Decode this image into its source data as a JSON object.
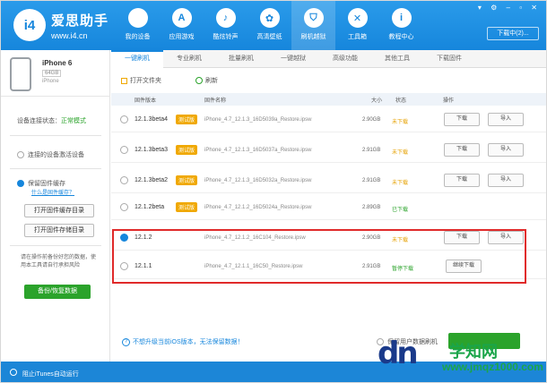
{
  "app": {
    "brand": "爱思助手",
    "url": "www.i4.cn",
    "logo": "i4",
    "download_center": "下载中(2)..."
  },
  "nav": [
    {
      "label": "我的设备",
      "icon": ""
    },
    {
      "label": "应用游戏",
      "icon": "A"
    },
    {
      "label": "酷炫铃声",
      "icon": "♪"
    },
    {
      "label": "高清壁纸",
      "icon": "✿"
    },
    {
      "label": "刷机越狱",
      "icon": "⛉"
    },
    {
      "label": "工具箱",
      "icon": "✕"
    },
    {
      "label": "教程中心",
      "icon": "i"
    }
  ],
  "device": {
    "name": "iPhone 6",
    "capacity": "64GB",
    "color": "iPhone"
  },
  "sidebar": {
    "status_label": "设备连接状态：",
    "status_value": "正常模式",
    "opt1": "连接的设备激活设备",
    "opt2": "保留固件缓存",
    "opt2_link": "什么是固件缓存？",
    "btn1": "打开固件缓存目录",
    "btn2": "打开固件存储目录",
    "note": "请在操作前备份好您的数据，使用本工具请自行承担风险",
    "backup": "备份/恢复数据",
    "itunes": "阻止iTunes自动运行"
  },
  "tabs": [
    "一键刷机",
    "专业刷机",
    "批量刷机",
    "一键越狱",
    "高级功能",
    "其他工具",
    "下载固件"
  ],
  "toolbar": {
    "open": "打开文件夹",
    "refresh": "刷新"
  },
  "table": {
    "headers": {
      "version": "固件版本",
      "name": "固件名称",
      "size": "大小",
      "status": "状态",
      "action": "操作"
    },
    "rows": [
      {
        "version": "12.1.3beta4",
        "tag": "测试版",
        "name": "iPhone_4.7_12.1.3_16D5039a_Restore.ipsw",
        "size": "2.90GB",
        "status": "未下载",
        "status_color": "#e6a100",
        "b1": "下载",
        "b2": "导入",
        "selected": false
      },
      {
        "version": "12.1.3beta3",
        "tag": "测试版",
        "name": "iPhone_4.7_12.1.3_16D5037a_Restore.ipsw",
        "size": "2.91GB",
        "status": "未下载",
        "status_color": "#e6a100",
        "b1": "下载",
        "b2": "导入",
        "selected": false
      },
      {
        "version": "12.1.3beta2",
        "tag": "测试版",
        "name": "iPhone_4.7_12.1.3_16D5032a_Restore.ipsw",
        "size": "2.91GB",
        "status": "未下载",
        "status_color": "#e6a100",
        "b1": "下载",
        "b2": "导入",
        "selected": false
      },
      {
        "version": "12.1.2beta",
        "tag": "测试版",
        "name": "iPhone_4.7_12.1.2_16D5024a_Restore.ipsw",
        "size": "2.89GB",
        "status": "已下载",
        "status_color": "#2ba32b",
        "b1": "",
        "b2": "",
        "selected": false
      },
      {
        "version": "12.1.2",
        "tag": "",
        "name": "iPhone_4.7_12.1.2_16C104_Restore.ipsw",
        "size": "2.90GB",
        "status": "未下载",
        "status_color": "#e6a100",
        "b1": "下载",
        "b2": "导入",
        "selected": true
      },
      {
        "version": "12.1.1",
        "tag": "",
        "name": "iPhone_4.7_12.1.1_16C50_Restore.ipsw",
        "size": "2.91GB",
        "status": "暂停下载",
        "status_color": "#2ba32b",
        "b1": "继续下载",
        "b2": "",
        "selected": false
      }
    ]
  },
  "footer": {
    "info": "不想升级当前iOS版本，无法保留数据！",
    "option": "保留用户数据刷机"
  },
  "watermark": {
    "dn": "dn",
    "t1": "学知网",
    "t2": "www.jmqz1000.com"
  }
}
